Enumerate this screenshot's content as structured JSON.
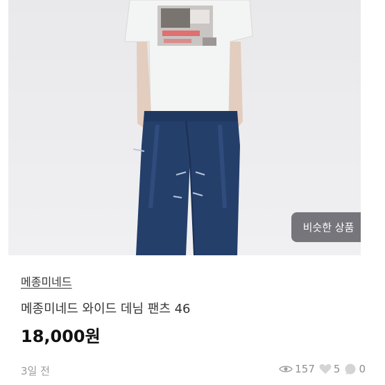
{
  "product": {
    "shop_name": "메종미네드",
    "title": "메종미네드 와이드 데님 팬츠 46",
    "price": "18,000원",
    "posted": "3일 전"
  },
  "similar_button": {
    "label": "비슷한 상품",
    "icon": "chevron-right-icon"
  },
  "stats": {
    "views": "157",
    "likes": "5",
    "chats": "0"
  },
  "colors": {
    "similar_bg": "#5a5a60",
    "text_main": "#333333",
    "text_muted": "#9b9b9b"
  }
}
